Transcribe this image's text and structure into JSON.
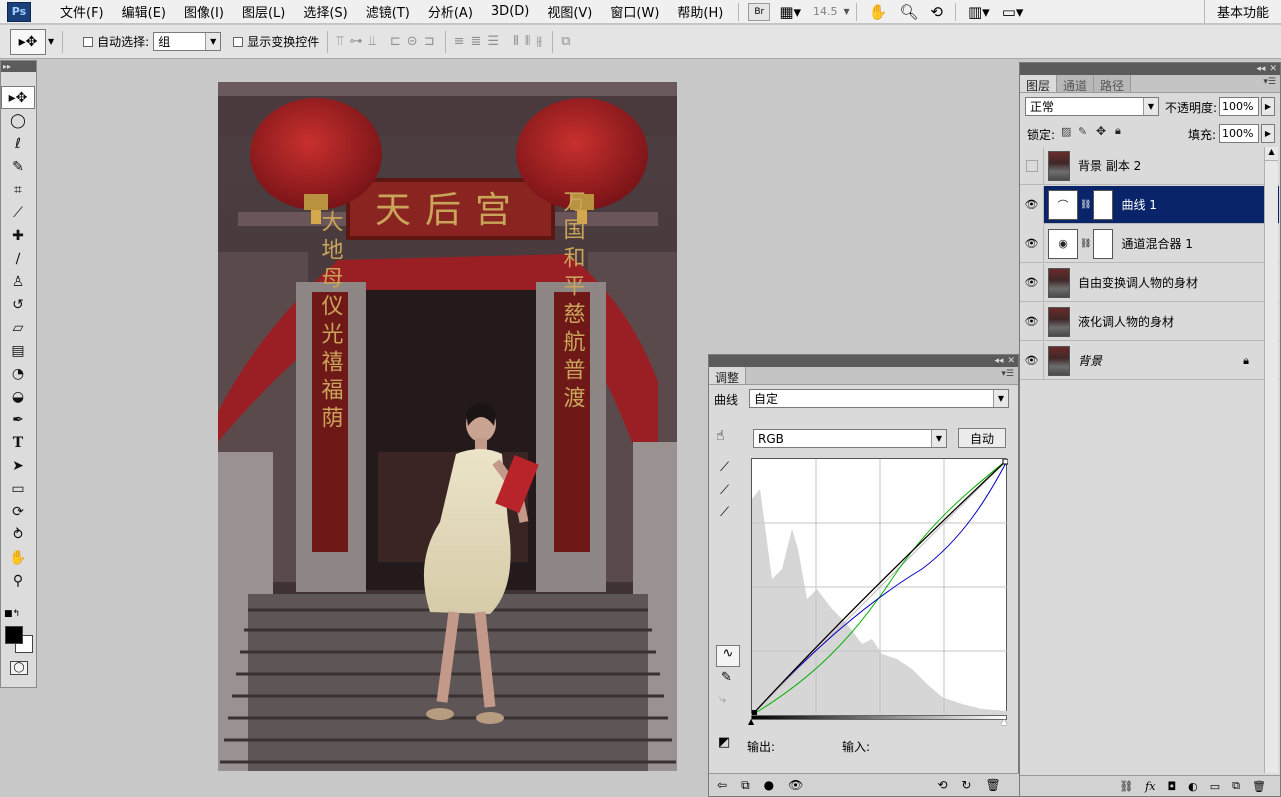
{
  "app": {
    "logo": "Ps"
  },
  "menu": [
    "文件(F)",
    "编辑(E)",
    "图像(I)",
    "图层(L)",
    "选择(S)",
    "滤镜(T)",
    "分析(A)",
    "3D(D)",
    "视图(V)",
    "窗口(W)",
    "帮助(H)"
  ],
  "menubar": {
    "br_label": "Br",
    "zoom": "14.5",
    "workspace": "基本功能"
  },
  "options": {
    "auto_select_label": "自动选择:",
    "auto_select_value": "组",
    "show_transform_label": "显示变换控件"
  },
  "adjustments": {
    "tab_label": "调整",
    "curves_label": "曲线",
    "preset_value": "自定",
    "channel_value": "RGB",
    "auto_button": "自动",
    "output_label": "输出:",
    "input_label": "输入:",
    "curve_colors": {
      "rgb": "#000000",
      "red": "#c00000",
      "green": "#00b000",
      "blue": "#0000c0"
    }
  },
  "layers_panel": {
    "tabs": [
      "图层",
      "通道",
      "路径"
    ],
    "blend_mode": "正常",
    "opacity_label": "不透明度:",
    "opacity_value": "100%",
    "lock_label": "锁定:",
    "fill_label": "填充:",
    "fill_value": "100%",
    "layers": [
      {
        "name": "背景 副本 2",
        "visible": false,
        "kind": "image"
      },
      {
        "name": "曲线 1",
        "visible": true,
        "kind": "curves",
        "selected": true
      },
      {
        "name": "通道混合器 1",
        "visible": true,
        "kind": "channel-mixer"
      },
      {
        "name": "自由变换调人物的身材",
        "visible": true,
        "kind": "image"
      },
      {
        "name": "液化调人物的身材",
        "visible": true,
        "kind": "image"
      },
      {
        "name": "背景",
        "visible": true,
        "kind": "image",
        "locked": true
      }
    ]
  },
  "photo": {
    "plaque_text": "天后宫",
    "left_couplet": "大地母仪光禧福荫",
    "right_couplet": "万国和平慈航普渡"
  }
}
